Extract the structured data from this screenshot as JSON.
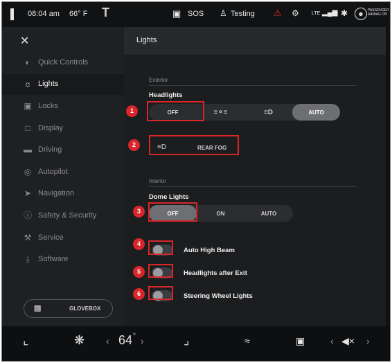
{
  "status_bar": {
    "time": "08:04 am",
    "temperature": "66° F",
    "sos": "SOS",
    "profile": "Testing",
    "lte": "LTE",
    "airbag_line1": "PASSENGER",
    "airbag_line2": "AIRBAG ON"
  },
  "sidebar": {
    "items": [
      {
        "label": "Quick Controls",
        "icon": "toggle-icon"
      },
      {
        "label": "Lights",
        "icon": "sun-icon"
      },
      {
        "label": "Locks",
        "icon": "lock-icon"
      },
      {
        "label": "Display",
        "icon": "display-icon"
      },
      {
        "label": "Driving",
        "icon": "car-icon"
      },
      {
        "label": "Autopilot",
        "icon": "steering-wheel-icon"
      },
      {
        "label": "Navigation",
        "icon": "navigation-arrow-icon"
      },
      {
        "label": "Safety & Security",
        "icon": "info-icon"
      },
      {
        "label": "Service",
        "icon": "wrench-icon"
      },
      {
        "label": "Software",
        "icon": "download-icon"
      }
    ],
    "active_item": "Lights",
    "glovebox_label": "GLOVEBOX"
  },
  "panel": {
    "title": "Lights",
    "exterior_label": "Exterior",
    "headlights_label": "Headlights",
    "headlights_options": [
      "OFF",
      "",
      "",
      "AUTO"
    ],
    "headlights_selected": "AUTO",
    "rear_fog_label": "REAR FOG",
    "interior_label": "Interior",
    "dome_lights_label": "Dome Lights",
    "dome_options": [
      "OFF",
      "ON",
      "AUTO"
    ],
    "dome_selected": "OFF",
    "toggles": [
      {
        "label": "Auto High Beam",
        "on": false
      },
      {
        "label": "Headlights after Exit",
        "on": false
      },
      {
        "label": "Steering Wheel Lights",
        "on": false
      }
    ]
  },
  "callouts": [
    "1",
    "2",
    "3",
    "4",
    "5",
    "6"
  ],
  "climate_bar": {
    "temperature": "64",
    "degree": "°"
  },
  "colors": {
    "highlight_red": "#d8262b",
    "background": "#1c1d1f",
    "selected_segment": "#6e6f73"
  }
}
